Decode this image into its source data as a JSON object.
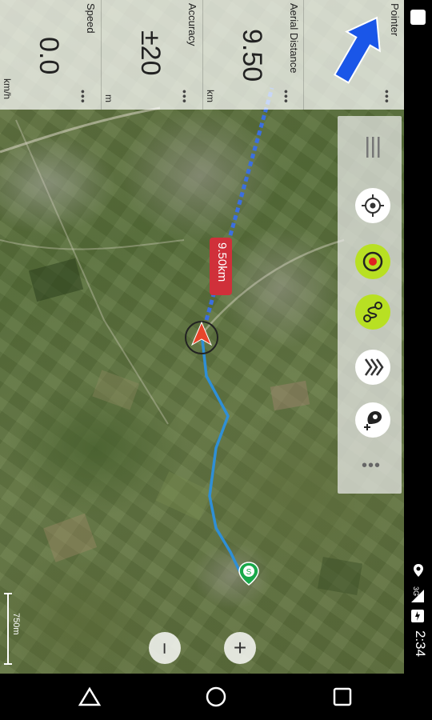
{
  "panel": {
    "pointer": {
      "title": "Pointer",
      "dots": "•••"
    },
    "aerial_distance": {
      "title": "Aerial Distance",
      "value": "9.50",
      "unit": "km",
      "dots": "•••"
    },
    "accuracy": {
      "title": "Accuracy",
      "value": "±20",
      "unit": "m",
      "dots": "•••"
    },
    "speed": {
      "title": "Speed",
      "value": "0.0",
      "unit": "km/h",
      "dots": "•••"
    }
  },
  "map": {
    "distance_label": "9.50km",
    "start_marker": "S",
    "scale": "750m",
    "colors": {
      "track": "#2f8fd6",
      "aerial_line": "#3b6fe0",
      "pointer_arrow": "#1a56e8",
      "marker_red": "#e8452a",
      "start_green": "#19a84a"
    }
  },
  "toolbar": {
    "items": [
      "menu-icon",
      "center-location-icon",
      "target-icon",
      "route-icon",
      "layers-icon",
      "add-waypoint-icon",
      "more-icon"
    ],
    "more_label": "•••"
  },
  "zoom": {
    "minus": "−",
    "plus": "+"
  },
  "status_bar": {
    "time": "2:34",
    "network": "3G"
  },
  "nav": {
    "items": [
      "back-icon",
      "home-icon",
      "recents-icon"
    ]
  }
}
